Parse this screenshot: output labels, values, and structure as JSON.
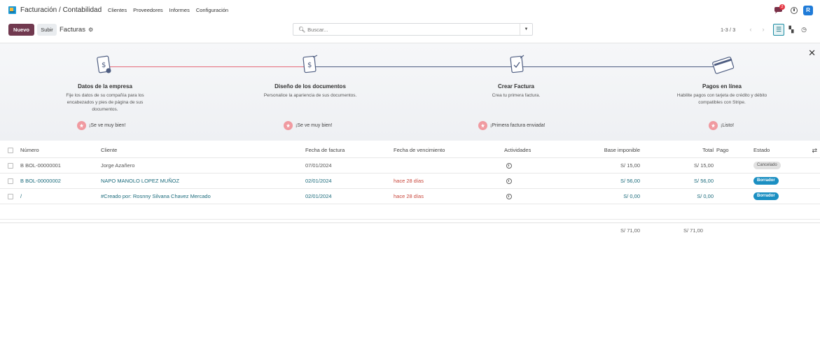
{
  "app": {
    "name": "Facturación / Contabilidad",
    "menu": [
      "Clientes",
      "Proveedores",
      "Informes",
      "Configuración"
    ],
    "chat_count": "2",
    "avatar_letter": "R"
  },
  "controls": {
    "new_label": "Nuevo",
    "upload_label": "Subir",
    "breadcrumb": "Facturas",
    "search_placeholder": "Buscar...",
    "pager": "1-3 / 3"
  },
  "onboarding": {
    "steps": [
      {
        "title": "Datos de la empresa",
        "desc": "Fije los datos de su compañía para los encabezados y pies de página de sus documentos.",
        "status": "¡Se ve muy bien!"
      },
      {
        "title": "Diseño de los documentos",
        "desc": "Personalice la apariencia de sus documentos.",
        "status": "¡Se ve muy bien!"
      },
      {
        "title": "Crear Factura",
        "desc": "Crea tu primera factura.",
        "status": "¡Primera factura enviada!"
      },
      {
        "title": "Pagos en línea",
        "desc": "Habilite pagos con tarjeta de crédito y débito compatibles con Stripe.",
        "status": "¡Listo!"
      }
    ]
  },
  "table": {
    "headers": {
      "number": "Número",
      "client": "Cliente",
      "invoice_date": "Fecha de factura",
      "due_date": "Fecha de vencimiento",
      "activities": "Actividades",
      "tax_base": "Base imponible",
      "total": "Total",
      "payment": "Pago",
      "state": "Estado"
    },
    "rows": [
      {
        "number": "B BOL-00000001",
        "client": "Jorge Azañero",
        "invoice_date": "07/01/2024",
        "due_date": "",
        "tax_base": "S/ 15,00",
        "total": "S/ 15,00",
        "state": "Cancelado"
      },
      {
        "number": "B BOL-00000002",
        "client": "NAPO MANOLO LOPEZ MUÑOZ",
        "invoice_date": "02/01/2024",
        "due_date": "hace 28 días",
        "tax_base": "S/ 56,00",
        "total": "S/ 56,00",
        "state": "Borrador"
      },
      {
        "number": "/",
        "client": "#Creado por: Rosnny Silvana Chavez Mercado",
        "invoice_date": "02/01/2024",
        "due_date": "hace 28 días",
        "tax_base": "S/ 0,00",
        "total": "S/ 0,00",
        "state": "Borrador"
      }
    ],
    "totals": {
      "tax_base": "S/ 71,00",
      "total": "S/ 71,00"
    }
  },
  "colors": {
    "primary": "#71394f",
    "accent": "#1b8fc2",
    "link": "#1a6a7b",
    "danger": "#c8463b"
  }
}
